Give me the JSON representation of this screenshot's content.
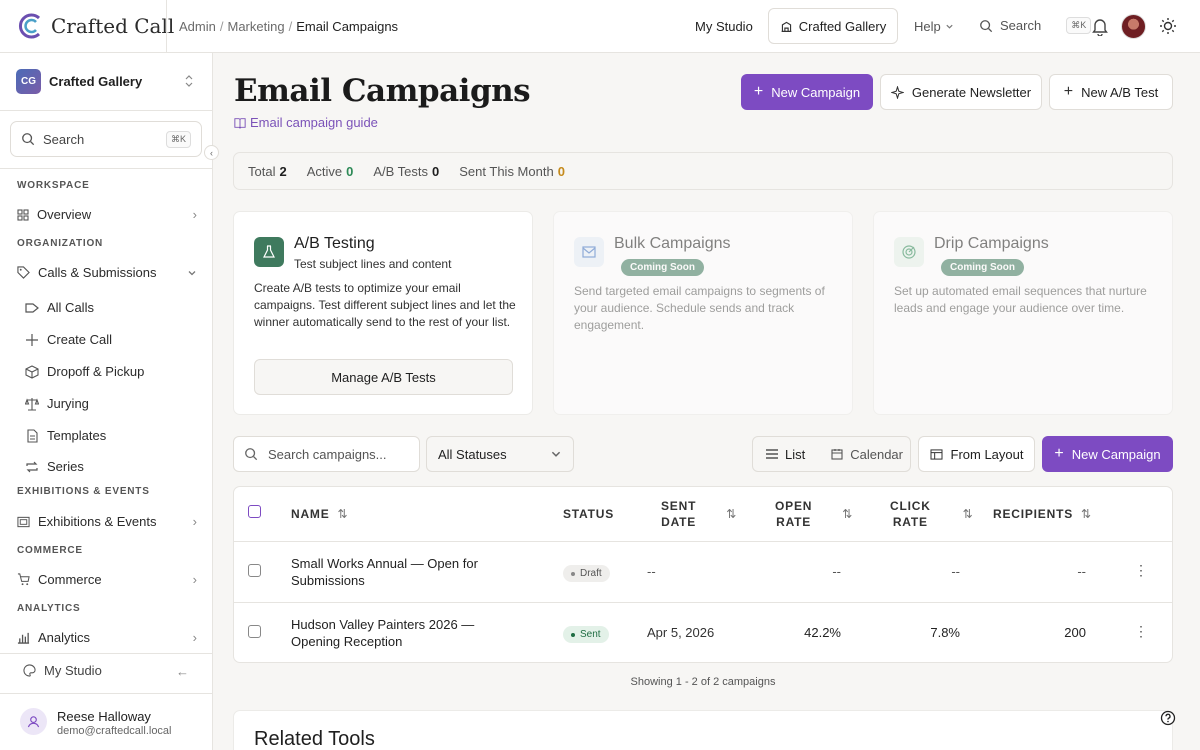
{
  "app": {
    "name": "Crafted Call"
  },
  "breadcrumb": [
    "Admin",
    "Marketing",
    "Email Campaigns"
  ],
  "topbar": {
    "my_studio": "My Studio",
    "gallery": "Crafted Gallery",
    "help": "Help",
    "search": "Search",
    "search_kbd": "⌘K"
  },
  "sidebar": {
    "workspace_initials": "CG",
    "workspace_name": "Crafted Gallery",
    "search_label": "Search",
    "search_kbd": "⌘K",
    "sections": {
      "workspace": "WORKSPACE",
      "organization": "ORGANIZATION",
      "exhibitions": "EXHIBITIONS & EVENTS",
      "commerce": "COMMERCE",
      "analytics": "ANALYTICS"
    },
    "items": {
      "overview": "Overview",
      "calls": "Calls & Submissions",
      "exhibitions": "Exhibitions & Events",
      "commerce": "Commerce",
      "analytics": "Analytics"
    },
    "subitems": [
      "All Calls",
      "Create Call",
      "Dropoff & Pickup",
      "Jurying",
      "Templates",
      "Series"
    ],
    "my_studio": "My Studio",
    "user_name": "Reese Halloway",
    "user_email": "demo@craftedcall.local"
  },
  "page": {
    "title": "Email Campaigns",
    "guide_link": "Email campaign guide",
    "new_campaign": "New Campaign",
    "generate_newsletter": "Generate Newsletter",
    "new_ab_test": "New A/B Test"
  },
  "stats": [
    {
      "label": "Total",
      "value": "2"
    },
    {
      "label": "Active",
      "value": "0"
    },
    {
      "label": "A/B Tests",
      "value": "0"
    },
    {
      "label": "Sent This Month",
      "value": "0"
    }
  ],
  "cards": {
    "ab": {
      "title": "A/B Testing",
      "subtitle": "Test subject lines and content",
      "desc": "Create A/B tests to optimize your email campaigns. Test different subject lines and let the winner automatically send to the rest of your list.",
      "button": "Manage A/B Tests"
    },
    "bulk": {
      "title": "Bulk Campaigns",
      "badge": "Coming Soon",
      "desc": "Send targeted email campaigns to segments of your audience. Schedule sends and track engagement."
    },
    "drip": {
      "title": "Drip Campaigns",
      "badge": "Coming Soon",
      "desc": "Set up automated email sequences that nurture leads and engage your audience over time."
    }
  },
  "filters": {
    "search_placeholder": "Search campaigns...",
    "status": "All Statuses",
    "view_list": "List",
    "view_calendar": "Calendar",
    "from_layout": "From Layout",
    "new_campaign": "New Campaign"
  },
  "table": {
    "headers": {
      "name": "NAME",
      "status": "STATUS",
      "sent_date_1": "SENT",
      "sent_date_2": "DATE",
      "open_1": "OPEN",
      "open_2": "RATE",
      "click_1": "CLICK",
      "click_2": "RATE",
      "recipients": "RECIPIENTS"
    },
    "rows": [
      {
        "name": "Small Works Annual — Open for Submissions",
        "status": "Draft",
        "sent_date": "--",
        "open_rate": "--",
        "click_rate": "--",
        "recipients": "--"
      },
      {
        "name": "Hudson Valley Painters 2026 — Opening Reception",
        "status": "Sent",
        "sent_date": "Apr 5, 2026",
        "open_rate": "42.2%",
        "click_rate": "7.8%",
        "recipients": "200"
      }
    ],
    "showing": "Showing 1 - 2 of 2 campaigns"
  },
  "related": {
    "title": "Related Tools"
  },
  "colors": {
    "primary": "#7d4bc2",
    "success": "#2e8a57",
    "accent_green": "#3f7a5e"
  }
}
